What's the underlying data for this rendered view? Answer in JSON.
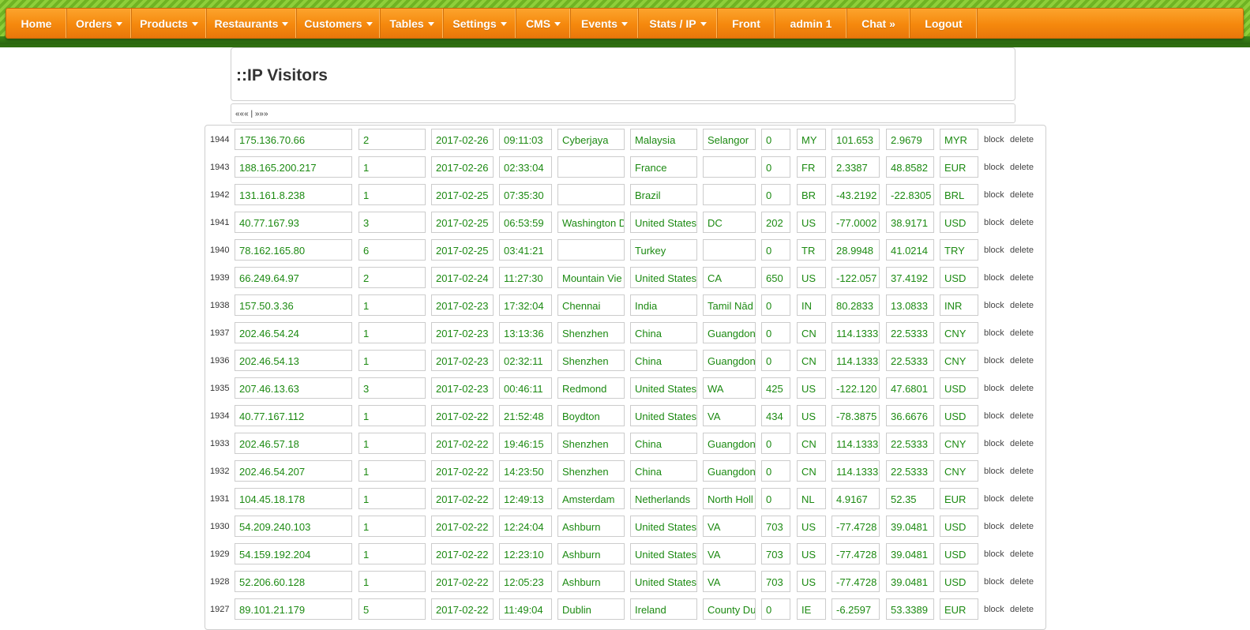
{
  "nav": {
    "items": [
      {
        "name": "home",
        "label": "Home",
        "dropdown": false
      },
      {
        "name": "orders",
        "label": "Orders",
        "dropdown": true
      },
      {
        "name": "products",
        "label": "Products",
        "dropdown": true
      },
      {
        "name": "restaurants",
        "label": "Restaurants",
        "dropdown": true
      },
      {
        "name": "customers",
        "label": "Customers",
        "dropdown": true
      },
      {
        "name": "tables",
        "label": "Tables",
        "dropdown": true
      },
      {
        "name": "settings",
        "label": "Settings",
        "dropdown": true
      },
      {
        "name": "cms",
        "label": "CMS",
        "dropdown": true
      },
      {
        "name": "events",
        "label": "Events",
        "dropdown": true
      },
      {
        "name": "stats-ip",
        "label": "Stats / IP",
        "dropdown": true
      },
      {
        "name": "front",
        "label": "Front",
        "dropdown": false
      },
      {
        "name": "admin",
        "label": "admin 1",
        "dropdown": false
      },
      {
        "name": "chat",
        "label": "Chat »",
        "dropdown": false
      },
      {
        "name": "logout",
        "label": "Logout",
        "dropdown": false
      }
    ]
  },
  "page": {
    "title": "::IP Visitors",
    "pager": "«««  |  »»»"
  },
  "actions": {
    "block": "block",
    "delete": "delete"
  },
  "colors": {
    "nav_orange": "#f5880d",
    "value_green": "#1c8a12",
    "topbar_green": "#6fb323"
  },
  "rows": [
    {
      "id": "1944",
      "ip": "175.136.70.66",
      "visits": "2",
      "date": "2017-02-26",
      "time": "09:11:03",
      "city": "Cyberjaya",
      "country": "Malaysia",
      "region": "Selangor",
      "area": "0",
      "cc": "MY",
      "lon": "101.653",
      "lat": "2.9679",
      "currency": "MYR"
    },
    {
      "id": "1943",
      "ip": "188.165.200.217",
      "visits": "1",
      "date": "2017-02-26",
      "time": "02:33:04",
      "city": "",
      "country": "France",
      "region": "",
      "area": "0",
      "cc": "FR",
      "lon": "2.3387",
      "lat": "48.8582",
      "currency": "EUR"
    },
    {
      "id": "1942",
      "ip": "131.161.8.238",
      "visits": "1",
      "date": "2017-02-25",
      "time": "07:35:30",
      "city": "",
      "country": "Brazil",
      "region": "",
      "area": "0",
      "cc": "BR",
      "lon": "-43.2192",
      "lat": "-22.8305",
      "currency": "BRL"
    },
    {
      "id": "1941",
      "ip": "40.77.167.93",
      "visits": "3",
      "date": "2017-02-25",
      "time": "06:53:59",
      "city": "Washington D",
      "country": "United States",
      "region": "DC",
      "area": "202",
      "cc": "US",
      "lon": "-77.0002",
      "lat": "38.9171",
      "currency": "USD"
    },
    {
      "id": "1940",
      "ip": "78.162.165.80",
      "visits": "6",
      "date": "2017-02-25",
      "time": "03:41:21",
      "city": "",
      "country": "Turkey",
      "region": "",
      "area": "0",
      "cc": "TR",
      "lon": "28.9948",
      "lat": "41.0214",
      "currency": "TRY"
    },
    {
      "id": "1939",
      "ip": "66.249.64.97",
      "visits": "2",
      "date": "2017-02-24",
      "time": "11:27:30",
      "city": "Mountain Vie",
      "country": "United States",
      "region": "CA",
      "area": "650",
      "cc": "US",
      "lon": "-122.057",
      "lat": "37.4192",
      "currency": "USD"
    },
    {
      "id": "1938",
      "ip": "157.50.3.36",
      "visits": "1",
      "date": "2017-02-23",
      "time": "17:32:04",
      "city": "Chennai",
      "country": "India",
      "region": "Tamil Nād",
      "area": "0",
      "cc": "IN",
      "lon": "80.2833",
      "lat": "13.0833",
      "currency": "INR"
    },
    {
      "id": "1937",
      "ip": "202.46.54.24",
      "visits": "1",
      "date": "2017-02-23",
      "time": "13:13:36",
      "city": "Shenzhen",
      "country": "China",
      "region": "Guangdon",
      "area": "0",
      "cc": "CN",
      "lon": "114.1333",
      "lat": "22.5333",
      "currency": "CNY"
    },
    {
      "id": "1936",
      "ip": "202.46.54.13",
      "visits": "1",
      "date": "2017-02-23",
      "time": "02:32:11",
      "city": "Shenzhen",
      "country": "China",
      "region": "Guangdon",
      "area": "0",
      "cc": "CN",
      "lon": "114.1333",
      "lat": "22.5333",
      "currency": "CNY"
    },
    {
      "id": "1935",
      "ip": "207.46.13.63",
      "visits": "3",
      "date": "2017-02-23",
      "time": "00:46:11",
      "city": "Redmond",
      "country": "United States",
      "region": "WA",
      "area": "425",
      "cc": "US",
      "lon": "-122.120",
      "lat": "47.6801",
      "currency": "USD"
    },
    {
      "id": "1934",
      "ip": "40.77.167.112",
      "visits": "1",
      "date": "2017-02-22",
      "time": "21:52:48",
      "city": "Boydton",
      "country": "United States",
      "region": "VA",
      "area": "434",
      "cc": "US",
      "lon": "-78.3875",
      "lat": "36.6676",
      "currency": "USD"
    },
    {
      "id": "1933",
      "ip": "202.46.57.18",
      "visits": "1",
      "date": "2017-02-22",
      "time": "19:46:15",
      "city": "Shenzhen",
      "country": "China",
      "region": "Guangdon",
      "area": "0",
      "cc": "CN",
      "lon": "114.1333",
      "lat": "22.5333",
      "currency": "CNY"
    },
    {
      "id": "1932",
      "ip": "202.46.54.207",
      "visits": "1",
      "date": "2017-02-22",
      "time": "14:23:50",
      "city": "Shenzhen",
      "country": "China",
      "region": "Guangdon",
      "area": "0",
      "cc": "CN",
      "lon": "114.1333",
      "lat": "22.5333",
      "currency": "CNY"
    },
    {
      "id": "1931",
      "ip": "104.45.18.178",
      "visits": "1",
      "date": "2017-02-22",
      "time": "12:49:13",
      "city": "Amsterdam",
      "country": "Netherlands",
      "region": "North Holl",
      "area": "0",
      "cc": "NL",
      "lon": "4.9167",
      "lat": "52.35",
      "currency": "EUR"
    },
    {
      "id": "1930",
      "ip": "54.209.240.103",
      "visits": "1",
      "date": "2017-02-22",
      "time": "12:24:04",
      "city": "Ashburn",
      "country": "United States",
      "region": "VA",
      "area": "703",
      "cc": "US",
      "lon": "-77.4728",
      "lat": "39.0481",
      "currency": "USD"
    },
    {
      "id": "1929",
      "ip": "54.159.192.204",
      "visits": "1",
      "date": "2017-02-22",
      "time": "12:23:10",
      "city": "Ashburn",
      "country": "United States",
      "region": "VA",
      "area": "703",
      "cc": "US",
      "lon": "-77.4728",
      "lat": "39.0481",
      "currency": "USD"
    },
    {
      "id": "1928",
      "ip": "52.206.60.128",
      "visits": "1",
      "date": "2017-02-22",
      "time": "12:05:23",
      "city": "Ashburn",
      "country": "United States",
      "region": "VA",
      "area": "703",
      "cc": "US",
      "lon": "-77.4728",
      "lat": "39.0481",
      "currency": "USD"
    },
    {
      "id": "1927",
      "ip": "89.101.21.179",
      "visits": "5",
      "date": "2017-02-22",
      "time": "11:49:04",
      "city": "Dublin",
      "country": "Ireland",
      "region": "County Du",
      "area": "0",
      "cc": "IE",
      "lon": "-6.2597",
      "lat": "53.3389",
      "currency": "EUR"
    }
  ]
}
